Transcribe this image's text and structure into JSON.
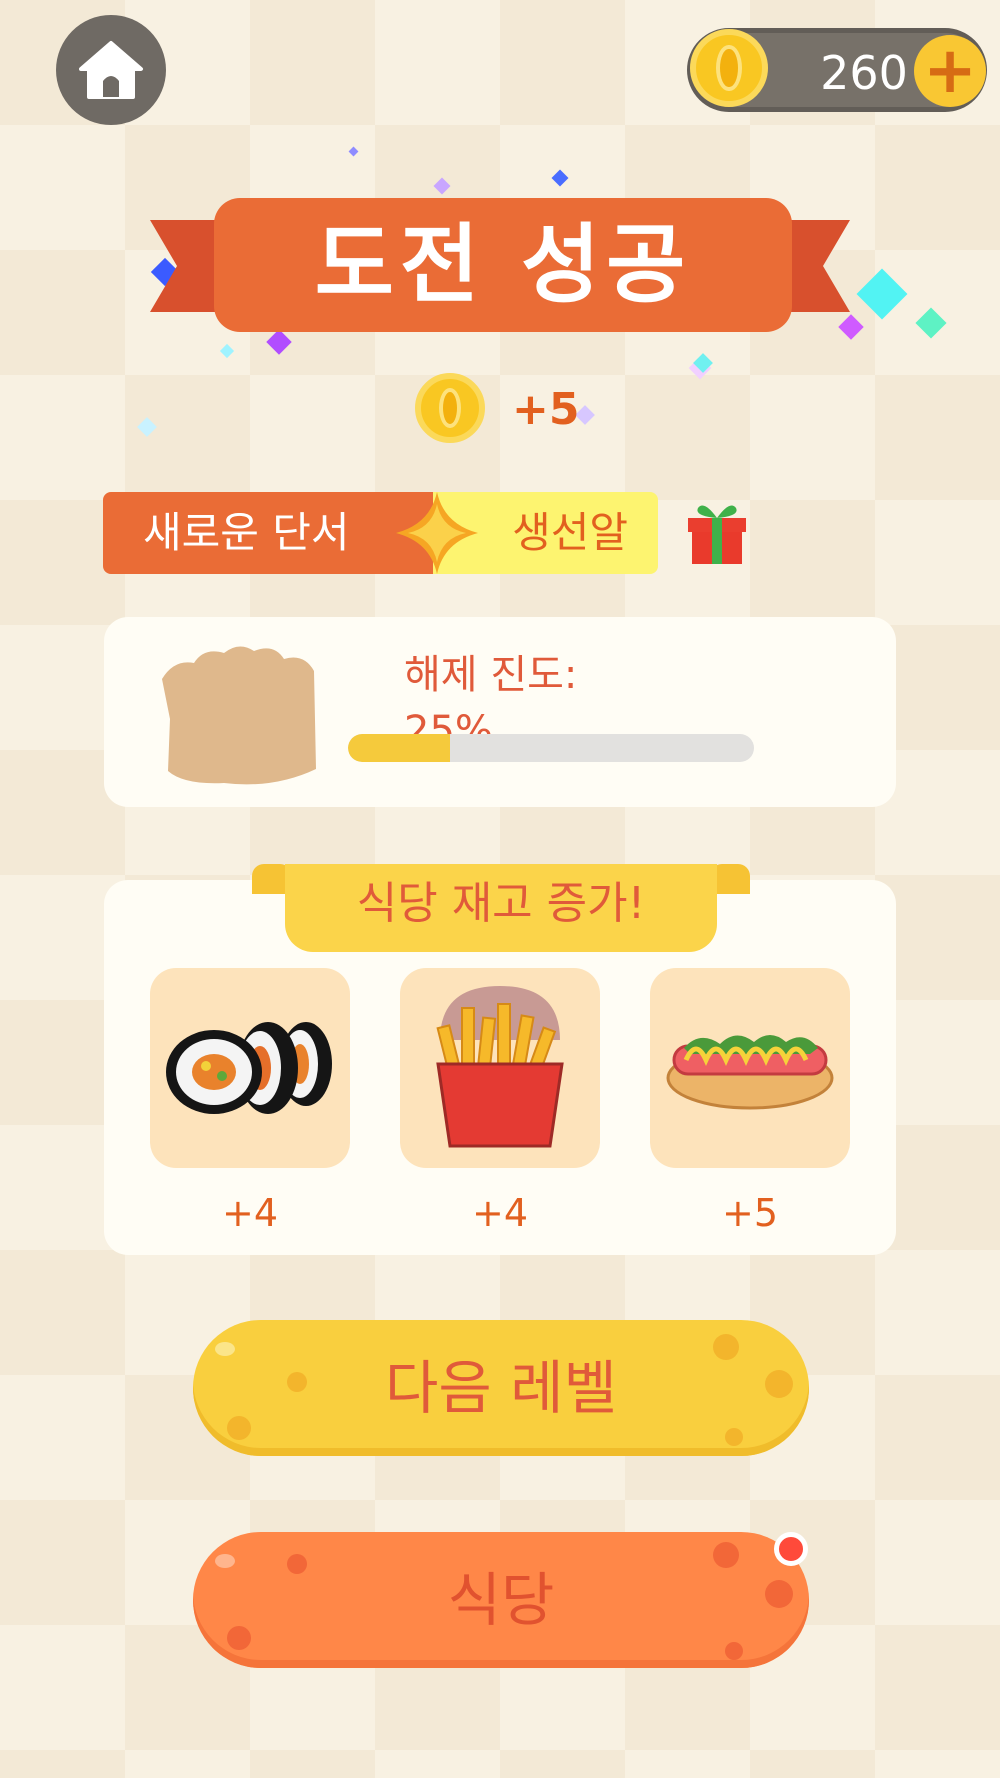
{
  "top_bar": {
    "coin_count": "260",
    "plus_label": "+"
  },
  "result": {
    "title": "도전 성공",
    "reward_amount": "+5"
  },
  "new_clue": {
    "label": "새로운 단서",
    "item": "생선알"
  },
  "unlock": {
    "progress_text": "해제 진도: 25%",
    "progress_fraction": 0.25
  },
  "stock": {
    "title": "식당 재고 증가!",
    "items": [
      {
        "icon": "gimbap-icon",
        "amount": "+4"
      },
      {
        "icon": "french-fries-icon",
        "amount": "+4"
      },
      {
        "icon": "hotdog-icon",
        "amount": "+5"
      }
    ]
  },
  "buttons": {
    "next_level": "다음 레벨",
    "restaurant": "식당"
  },
  "colors": {
    "accent_orange": "#ea6c36",
    "accent_yellow": "#f9cf3e",
    "text_red": "#e05a3a"
  }
}
